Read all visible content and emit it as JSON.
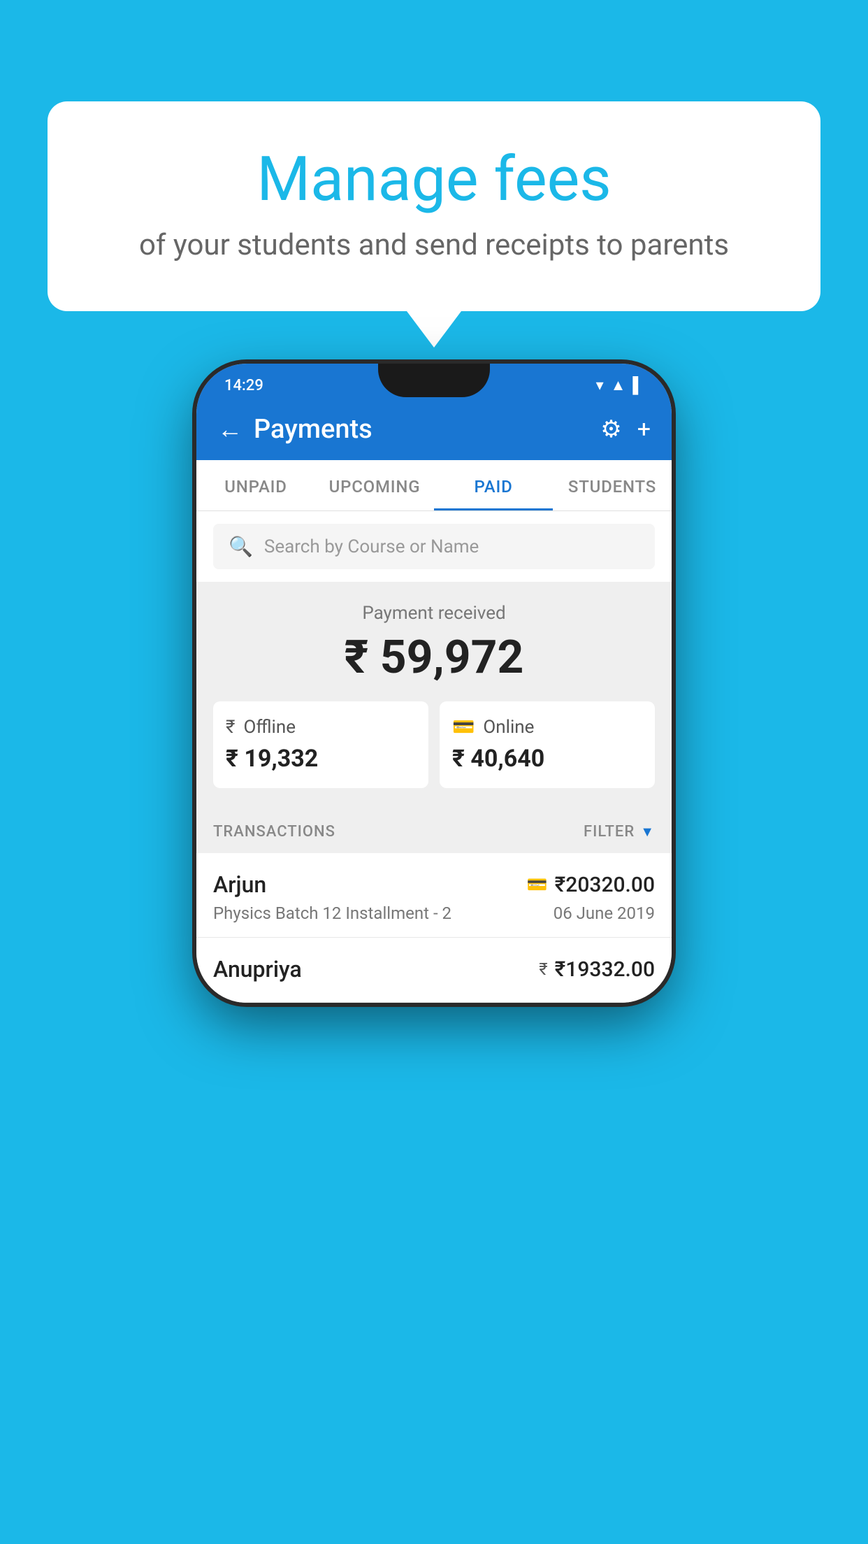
{
  "background_color": "#1BB8E8",
  "bubble": {
    "title": "Manage fees",
    "subtitle": "of your students and send receipts to parents"
  },
  "status_bar": {
    "time": "14:29",
    "icons": "▾◂▌"
  },
  "app_bar": {
    "title": "Payments",
    "back_icon": "←",
    "settings_icon": "⚙",
    "add_icon": "+"
  },
  "tabs": [
    {
      "label": "UNPAID",
      "active": false
    },
    {
      "label": "UPCOMING",
      "active": false
    },
    {
      "label": "PAID",
      "active": true
    },
    {
      "label": "STUDENTS",
      "active": false
    }
  ],
  "search": {
    "placeholder": "Search by Course or Name"
  },
  "payment_summary": {
    "label": "Payment received",
    "amount": "₹ 59,972",
    "offline": {
      "type": "Offline",
      "amount": "₹ 19,332"
    },
    "online": {
      "type": "Online",
      "amount": "₹ 40,640"
    }
  },
  "transactions": {
    "header_label": "TRANSACTIONS",
    "filter_label": "FILTER",
    "items": [
      {
        "name": "Arjun",
        "amount": "₹20320.00",
        "mode_icon": "card",
        "course": "Physics Batch 12 Installment - 2",
        "date": "06 June 2019"
      },
      {
        "name": "Anupriya",
        "amount": "₹19332.00",
        "mode_icon": "cash",
        "course": "",
        "date": ""
      }
    ]
  }
}
